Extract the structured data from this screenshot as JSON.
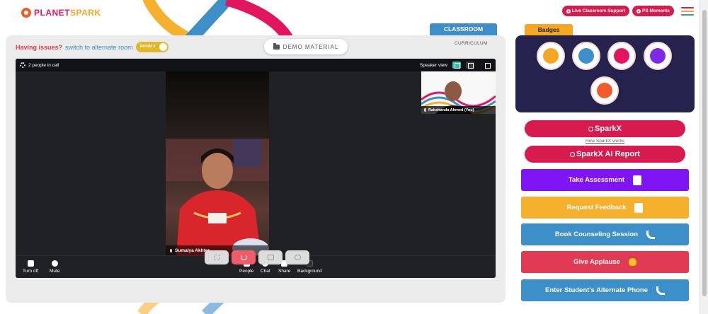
{
  "brand": {
    "name_part1": "PLANET",
    "name_part2": "SPARK"
  },
  "header": {
    "live_support_label": "Live Classroom Support",
    "ps_moments_label": "PS Moments",
    "hamburger_colors": [
      "#e2165e",
      "#f5a623",
      "#3d8fc9"
    ]
  },
  "classroom": {
    "tab_label": "CLASSROOM",
    "curriculum_label": "CURRICULUM",
    "issues_text": "Having issues?",
    "alternate_link": "switch to alternate room",
    "room_toggle_label": "ROOM 2",
    "demo_material_label": "DEMO MATERIAL"
  },
  "call": {
    "people_count": "2 people in call",
    "speaker_view_label": "Speaker view",
    "main_participant": "Sumaiya Akhter.",
    "self_participant": "Rakshanda Ahmed (You)",
    "controls": {
      "turn_off": "Turn off",
      "mute": "Mute",
      "people": "People",
      "chat": "Chat",
      "share": "Share",
      "background": "Background"
    }
  },
  "badges": {
    "tab_label": "Badges",
    "items": [
      {
        "icon": "trophy-badge-icon",
        "color": "#f5a623"
      },
      {
        "icon": "robot-badge-icon",
        "color": "#3d8fc9"
      },
      {
        "icon": "rocket-badge-icon",
        "color": "#e2165e"
      },
      {
        "icon": "medal-badge-icon",
        "color": "#7d2ae8"
      },
      {
        "icon": "star-badge-icon",
        "color": "#f15b2a"
      }
    ]
  },
  "actions": {
    "sparkx_label": "SparkX",
    "how_sparkx_label": "How SparkX works",
    "sparkx_ai_report_label": "SparkX AI Report",
    "take_assessment_label": "Take Assessment",
    "request_feedback_label": "Request Feedback",
    "book_counseling_label": "Book Counseling Session",
    "give_applause_label": "Give Applause",
    "alternate_phone_label": "Enter Student's Alternate Phone"
  },
  "colors": {
    "brand_pink": "#d81b4e",
    "assessment_purple": "#7f14f5",
    "feedback_orange": "#f5b02e",
    "counseling_blue": "#3d8fc9",
    "applause_red": "#e03a55",
    "phone_blue": "#3d8fc9",
    "badge_panel_navy": "#25224e"
  }
}
